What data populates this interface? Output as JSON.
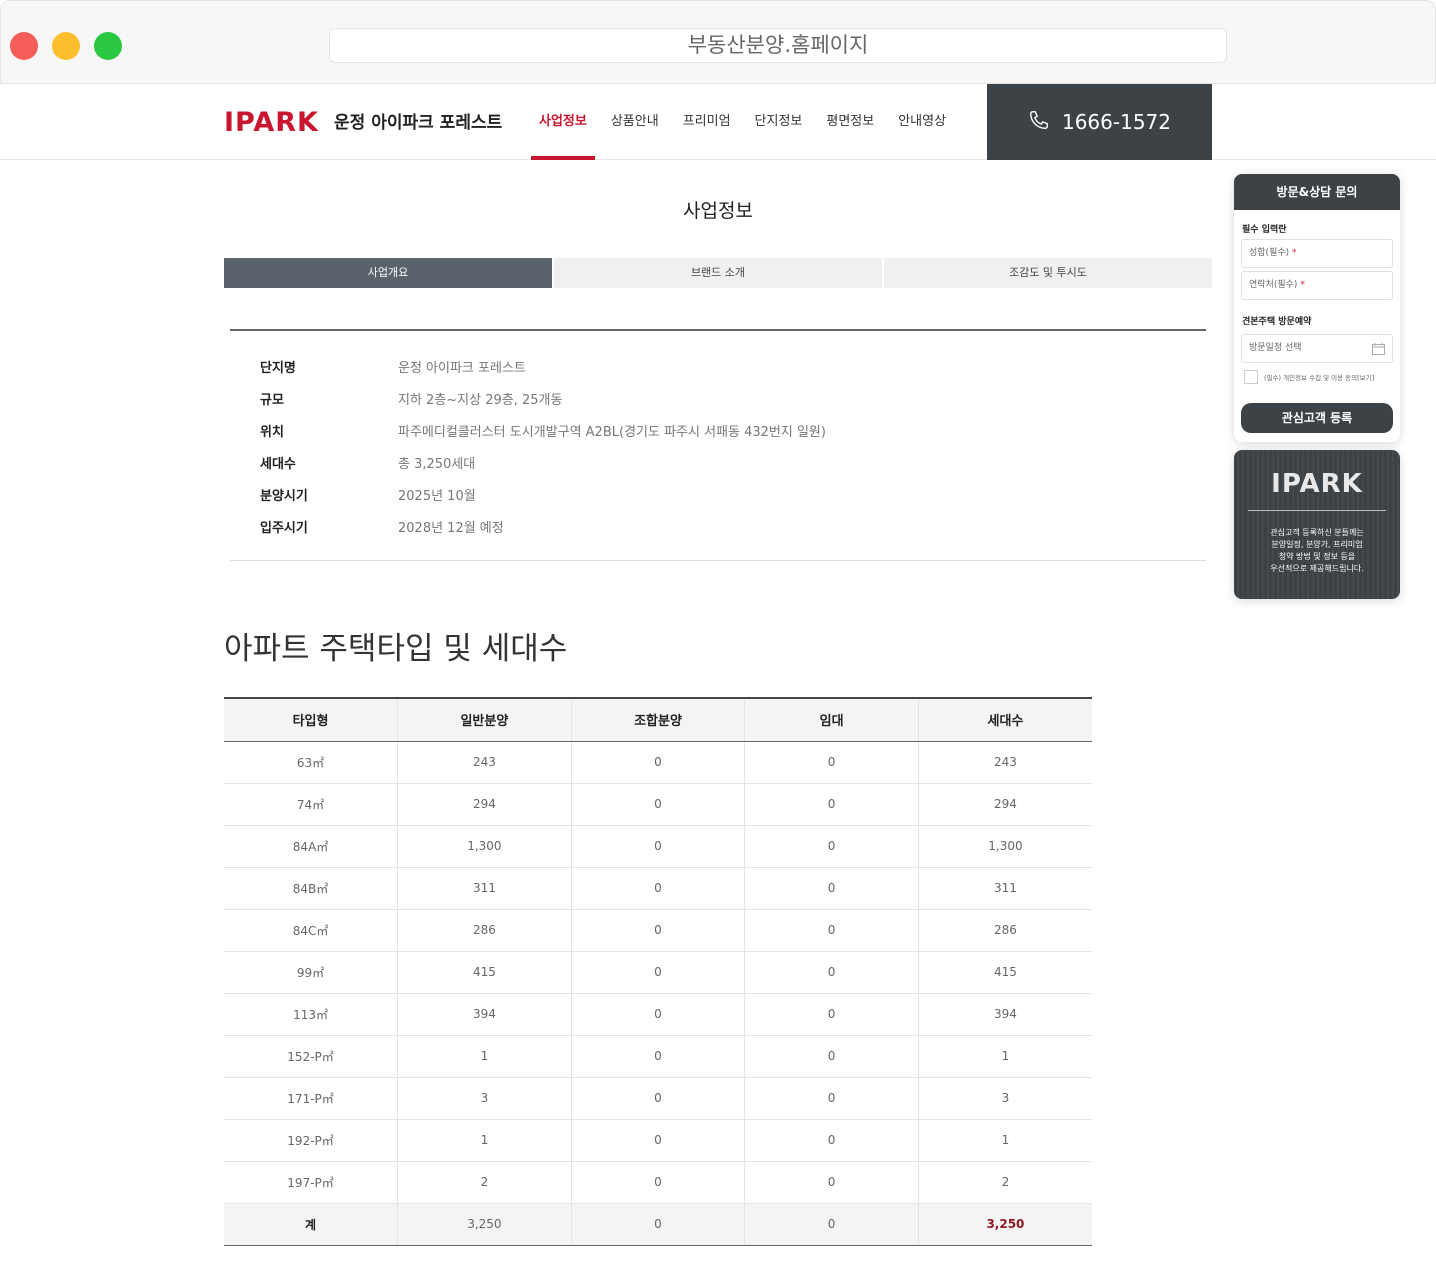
{
  "browser": {
    "url": "부동산분양.홈페이지"
  },
  "header": {
    "logo": "IPARK",
    "site_name": "운정 아이파크 포레스트",
    "nav": [
      {
        "label": "사업정보",
        "active": true
      },
      {
        "label": "상품안내",
        "active": false
      },
      {
        "label": "프리미엄",
        "active": false
      },
      {
        "label": "단지정보",
        "active": false
      },
      {
        "label": "평면정보",
        "active": false
      },
      {
        "label": "안내영상",
        "active": false
      }
    ],
    "phone": "1666-1572",
    "phone_icon": "phone-icon"
  },
  "page": {
    "title": "사업정보",
    "tabs": [
      "사업개요",
      "브랜드 소개",
      "조감도 및 투시도"
    ],
    "active_tab": 0
  },
  "overview": [
    {
      "key": "단지명",
      "value": "운정 아이파크 포레스트"
    },
    {
      "key": "규모",
      "value": "지하 2층~지상 29층, 25개동"
    },
    {
      "key": "위치",
      "value": "파주메디컬클러스터 도시개발구역 A2BL(경기도 파주시 서패동 432번지 일원)"
    },
    {
      "key": "세대수",
      "value": "총 3,250세대"
    },
    {
      "key": "분양시기",
      "value": "2025년 10월"
    },
    {
      "key": "입주시기",
      "value": "2028년 12월 예정"
    }
  ],
  "unit_section": {
    "title": "아파트 주택타입 및 세대수",
    "columns": [
      "타입형",
      "일반분양",
      "조합분양",
      "임대",
      "세대수"
    ],
    "rows": [
      [
        "63㎡",
        "243",
        "0",
        "0",
        "243"
      ],
      [
        "74㎡",
        "294",
        "0",
        "0",
        "294"
      ],
      [
        "84A㎡",
        "1,300",
        "0",
        "0",
        "1,300"
      ],
      [
        "84B㎡",
        "311",
        "0",
        "0",
        "311"
      ],
      [
        "84C㎡",
        "286",
        "0",
        "0",
        "286"
      ],
      [
        "99㎡",
        "415",
        "0",
        "0",
        "415"
      ],
      [
        "113㎡",
        "394",
        "0",
        "0",
        "394"
      ],
      [
        "152-P㎡",
        "1",
        "0",
        "0",
        "1"
      ],
      [
        "171-P㎡",
        "3",
        "0",
        "0",
        "3"
      ],
      [
        "192-P㎡",
        "1",
        "0",
        "0",
        "1"
      ],
      [
        "197-P㎡",
        "2",
        "0",
        "0",
        "2"
      ]
    ],
    "total": [
      "계",
      "3,250",
      "0",
      "0",
      "3,250"
    ]
  },
  "side_form": {
    "title": "방문&상담 문의",
    "required_label": "필수 입력란",
    "name_placeholder": "성함(필수)",
    "contact_placeholder": "연락처(필수)",
    "required_mark": "*",
    "visit_label": "견본주택 방문예약",
    "date_placeholder": "방문일정 선택",
    "calendar_icon": "calendar-icon",
    "agree_text": "(필수) 개인정보 수집 및 이용 동의[보기]",
    "submit": "관심고객 등록"
  },
  "side_promo": {
    "logo": "IPARK",
    "lines": [
      "관심고객 등록하신 분들께는",
      "분양일정, 분양가, 프리미엄",
      "청약 방법 및 정보 등을",
      "우선적으로 제공해드립니다."
    ]
  },
  "colors": {
    "brand_red": "#c8162f",
    "dark": "#3c4245",
    "tab_active": "#5a636b"
  }
}
